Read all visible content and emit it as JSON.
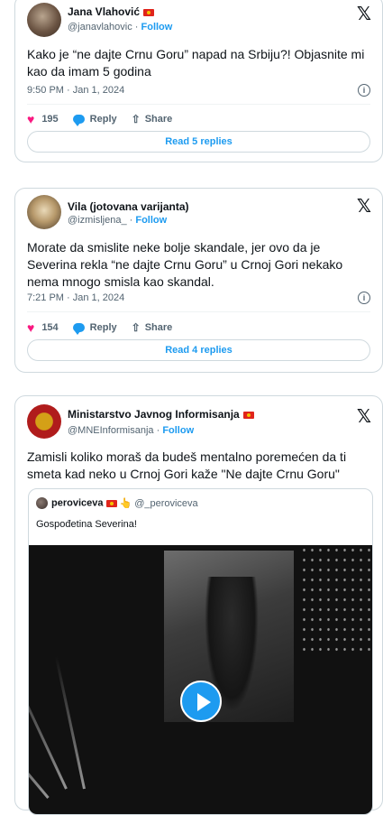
{
  "tweets": [
    {
      "name": "Jana Vlahović",
      "handle": "@janavlahovic",
      "follow": "Follow",
      "text": "Kako je “ne dajte Crnu Goru” napad na Srbiju?! Objasnite mi kao da imam 5 godina",
      "meta": "9:50 PM · Jan 1, 2024",
      "likes": "195",
      "reply": "Reply",
      "share": "Share",
      "replies_button": "Read 5 replies"
    },
    {
      "name": "Vila (jotovana varijanta)",
      "handle": "@izmisljena_",
      "follow": "Follow",
      "text": "Morate da smislite neke bolje skandale, jer ovo da je Severina rekla “ne dajte Crnu Goru” u Crnoj Gori nekako nema mnogo smisla kao skandal.",
      "meta": "7:21 PM · Jan 1, 2024",
      "likes": "154",
      "reply": "Reply",
      "share": "Share",
      "replies_button": "Read 4 replies"
    },
    {
      "name": "Ministarstvo Javnog Informisanja",
      "handle": "@MNEInformisanja",
      "follow": "Follow",
      "text": "Zamisli koliko moraš da budeš mentalno poremećen da ti smeta kad neko u Crnoj Gori kaže \"Ne dajte Crnu Goru\"",
      "quote": {
        "name": "peroviceva",
        "handle": "@_peroviceva",
        "text": "Gospođetina Severina!"
      }
    }
  ],
  "colors": {
    "accent": "#1d9bf0",
    "like": "#f91880",
    "muted": "#536471"
  },
  "icons": {
    "brand": "x-logo-icon",
    "like": "heart-icon",
    "reply": "reply-bubble-icon",
    "share": "share-icon",
    "info": "info-icon",
    "video": "play-icon"
  }
}
